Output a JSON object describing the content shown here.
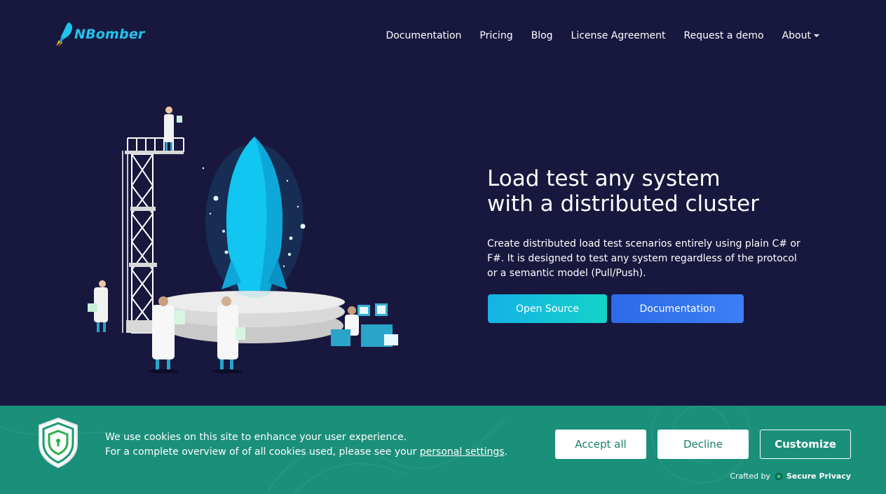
{
  "brand": {
    "name": "NBomber",
    "color": "#22c3ee"
  },
  "nav": {
    "items": [
      {
        "label": "Documentation"
      },
      {
        "label": "Pricing"
      },
      {
        "label": "Blog"
      },
      {
        "label": "License Agreement"
      },
      {
        "label": "Request a demo"
      },
      {
        "label": "About"
      }
    ]
  },
  "hero": {
    "title_line1": "Load test any system",
    "title_line2": "with a distributed cluster",
    "description": "Create distributed load test scenarios entirely using plain C# or F#. It is designed to test any system regardless of the protocol or a semantic model (Pull/Push).",
    "btn_open_source": "Open Source",
    "btn_documentation": "Documentation"
  },
  "cookie": {
    "line1": "We use cookies on this site to enhance your user experience.",
    "line2_prefix": "For a complete overview of of all cookies used, please see your ",
    "line2_link": "personal settings",
    "line2_suffix": ".",
    "accept": "Accept all",
    "decline": "Decline",
    "customize": "Customize",
    "crafted_by": "Crafted by",
    "crafted_brand": "Secure Privacy"
  },
  "colors": {
    "background": "#18183f",
    "cookie_bg": "#1a8f79",
    "rocket": "#12c6f2"
  },
  "icons": {
    "logo": "rocket-icon",
    "about_caret": "caret-down-icon",
    "cookie_shield": "shield-lock-icon",
    "secure_privacy": "secure-privacy-icon"
  }
}
